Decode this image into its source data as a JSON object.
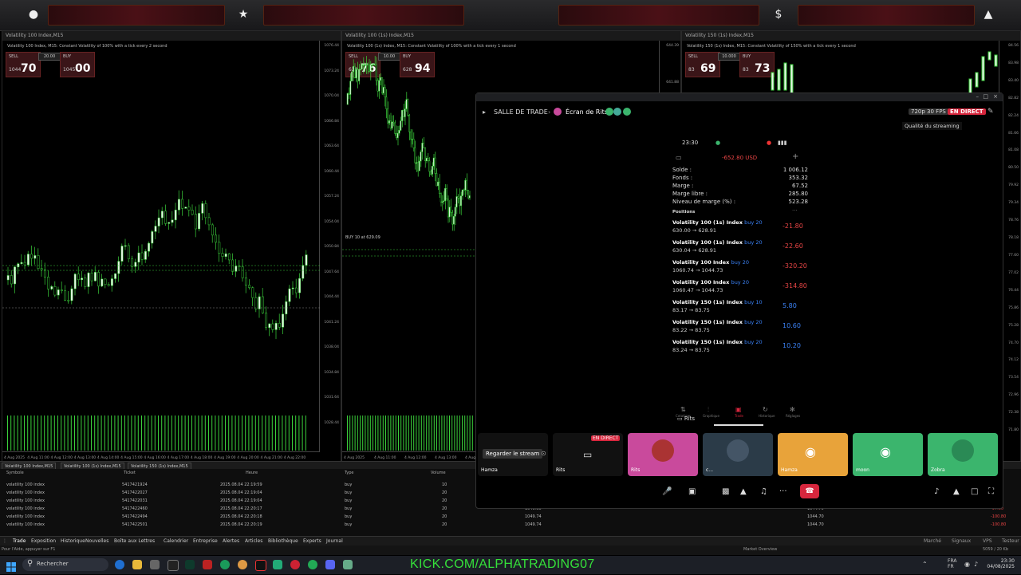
{
  "topbar": {
    "icons": [
      "user-icon",
      "star-icon",
      "dollar-icon",
      "flame-icon"
    ]
  },
  "panels": [
    {
      "title": "Volatility 100 Index,M15",
      "subtitle": "Volatility 100 Index, M15: Constant Volatility of 100% with a tick every 2 second",
      "sell_label": "SELL",
      "buy_label": "BUY",
      "lot": "20.00",
      "sell_pre": "1044",
      "sell_big": "70",
      "buy_pre": "1045",
      "buy_big": "00",
      "yticks": [
        "1076.44",
        "1073.24",
        "1070.04",
        "1066.84",
        "1063.64",
        "1060.44",
        "1057.24",
        "1054.04",
        "1050.84",
        "1047.64",
        "1044.44",
        "1041.24",
        "1038.04",
        "1034.84",
        "1031.64",
        "1028.44"
      ],
      "xticks": [
        "4 Aug 2025",
        "4 Aug 11:00",
        "4 Aug 12:00",
        "4 Aug 13:00",
        "4 Aug 14:00",
        "4 Aug 15:00",
        "4 Aug 16:00",
        "4 Aug 17:00",
        "4 Aug 18:00",
        "4 Aug 19:00",
        "4 Aug 20:00",
        "4 Aug 21:00",
        "4 Aug 22:00"
      ]
    },
    {
      "title": "Volatility 100 (1s) Index,M15",
      "subtitle": "Volatility 100 (1s) Index, M15: Constant Volatility of 100% with a tick every 1 second",
      "sell_label": "SELL",
      "buy_label": "BUY",
      "lot": "10.00",
      "sell_pre": "628",
      "sell_big": "76",
      "buy_pre": "628",
      "buy_big": "94",
      "order_label": "BUY 10 at 629.09",
      "yticks": [
        "644.39",
        "641.88",
        "639.37",
        "636.86",
        "634.35",
        "631.84",
        "629.33",
        "626.82",
        "624.31",
        "621.80",
        "619.29"
      ],
      "xticks": [
        "4 Aug 2025",
        "4 Aug 11:00",
        "4 Aug 12:00",
        "4 Aug 13:00",
        "4 Aug 14:00",
        "4 Aug 15:00",
        "4 Aug 16:00",
        "4 Aug 17:00",
        "4 Aug 18:00",
        "4 Aug 19:00"
      ]
    },
    {
      "title": "Volatility 150 (1s) Index,M15",
      "subtitle": "Volatility 150 (1s) Index, M15: Constant Volatility of 150% with a tick every 1 second",
      "sell_label": "SELL",
      "buy_label": "BUY",
      "lot": "10.000",
      "sell_pre": "83",
      "sell_big": "69",
      "buy_pre": "83",
      "buy_big": "73",
      "yticks": [
        "84.56",
        "83.98",
        "83.40",
        "82.82",
        "82.24",
        "81.66",
        "81.08",
        "80.50",
        "79.92",
        "79.34",
        "78.76",
        "78.18",
        "77.60",
        "77.02",
        "76.44",
        "75.86",
        "75.28",
        "74.70",
        "74.12",
        "73.54",
        "72.96",
        "72.38",
        "71.80"
      ],
      "xticks": []
    }
  ],
  "chart_tabs": [
    "Volatility 100 Index,M15",
    "Volatility 100 (1s) Index,M15",
    "Volatility 150 (1s) Index,M15"
  ],
  "terminal": {
    "headers": [
      "Symbole",
      "Ticket",
      "Heure",
      "Type",
      "Volume"
    ],
    "rows": [
      {
        "sym": "volatility 100 index",
        "ticket": "5417421924",
        "time": "2025.08.04 22:19:59",
        "type": "buy",
        "vol": "10",
        "p1": "",
        "p2": "",
        "pl": ""
      },
      {
        "sym": "volatility 100 index",
        "ticket": "5417422027",
        "time": "2025.08.04 22:19:04",
        "type": "buy",
        "vol": "20",
        "p1": "",
        "p2": "",
        "pl": ""
      },
      {
        "sym": "volatility 100 index",
        "ticket": "5417422031",
        "time": "2025.08.04 22:19:04",
        "type": "buy",
        "vol": "20",
        "p1": "",
        "p2": "",
        "pl": ""
      },
      {
        "sym": "volatility 100 index",
        "ticket": "5417422460",
        "time": "2025.08.04 22:20:17",
        "type": "buy",
        "vol": "20",
        "p1": "1049.55",
        "p2": "1044.70",
        "pl": "-97.00"
      },
      {
        "sym": "volatility 100 index",
        "ticket": "5417422494",
        "time": "2025.08.04 22:20:18",
        "type": "buy",
        "vol": "20",
        "p1": "1049.74",
        "p2": "1044.70",
        "pl": "-100.80"
      },
      {
        "sym": "volatility 100 index",
        "ticket": "5417422501",
        "time": "2025.08.04 22:20:19",
        "type": "buy",
        "vol": "20",
        "p1": "1049.74",
        "p2": "1044.70",
        "pl": "-100.80"
      }
    ],
    "tabs": [
      "Trade",
      "Exposition",
      "Historique",
      "Nouvelles",
      "Boîte aux Lettres",
      "Calendrier",
      "Entreprise",
      "Alertes",
      "Articles",
      "Bibliothèque",
      "Experts",
      "Journal"
    ],
    "status_left": "Pour l'Aide, appuyer sur F1",
    "status_mid": "Market Overview",
    "status_right": "5059 / 20 Kb",
    "right_tabs": [
      "Marché",
      "Signaux",
      "VPS",
      "Testeur"
    ]
  },
  "discord": {
    "channel": "SALLE DE TRADE",
    "stream_name": "Écran de Rits",
    "quality": "720p 30 FPS",
    "live": "EN DIRECT",
    "tooltip": "Qualité du streaming",
    "phone": {
      "time": "23:30",
      "equity": "-652.80 USD",
      "summary": [
        {
          "k": "Solde :",
          "v": "1 006.12"
        },
        {
          "k": "Fonds :",
          "v": "353.32"
        },
        {
          "k": "Marge :",
          "v": "67.52"
        },
        {
          "k": "Marge libre :",
          "v": "285.80"
        },
        {
          "k": "Niveau de marge (%) :",
          "v": "523.28"
        }
      ],
      "positions_label": "Positions",
      "positions": [
        {
          "name": "Volatility 100 (1s) Index",
          "dir": "buy 20",
          "prices": "630.00 → 628.91",
          "pl": "-21.80",
          "color": "#e84545"
        },
        {
          "name": "Volatility 100 (1s) Index",
          "dir": "buy 20",
          "prices": "630.04 → 628.91",
          "pl": "-22.60",
          "color": "#e84545"
        },
        {
          "name": "Volatility 100 Index",
          "dir": "buy 20",
          "prices": "1060.74 → 1044.73",
          "pl": "-320.20",
          "color": "#e84545"
        },
        {
          "name": "Volatility 100 Index",
          "dir": "buy 20",
          "prices": "1060.47 → 1044.73",
          "pl": "-314.80",
          "color": "#e84545"
        },
        {
          "name": "Volatility 150 (1s) Index",
          "dir": "buy 10",
          "prices": "83.17 → 83.75",
          "pl": "5.80",
          "color": "#3b82f6"
        },
        {
          "name": "Volatility 150 (1s) Index",
          "dir": "buy 20",
          "prices": "83.22 → 83.75",
          "pl": "10.60",
          "color": "#3b82f6"
        },
        {
          "name": "Volatility 150 (1s) Index",
          "dir": "buy 20",
          "prices": "83.24 → 83.75",
          "pl": "10.20",
          "color": "#3b82f6"
        }
      ],
      "nav": [
        "Cotations",
        "Graphique",
        "Trade",
        "Historique",
        "Réglages"
      ]
    },
    "watching": "Rits",
    "watch_btn": "Regarder le stream",
    "tiles": [
      {
        "name": "Hamza",
        "bg": "#111"
      },
      {
        "name": "Rits",
        "bg": "#111",
        "live": "EN DIRECT"
      },
      {
        "name": "Rits",
        "bg": "#c94a9c"
      },
      {
        "name": "c...",
        "bg": "#2b3b48"
      },
      {
        "name": "Hamza",
        "bg": "#e8a33a"
      },
      {
        "name": "moon",
        "bg": "#3bb56d"
      },
      {
        "name": "Zobra",
        "bg": "#3bb56d"
      }
    ]
  },
  "taskbar": {
    "search": "Rechercher",
    "lang": "FRA",
    "lang2": "FR",
    "time": "23:30",
    "date": "04/08/2025"
  },
  "overlay_text": "KICK.COM/ALPHATRADING07"
}
